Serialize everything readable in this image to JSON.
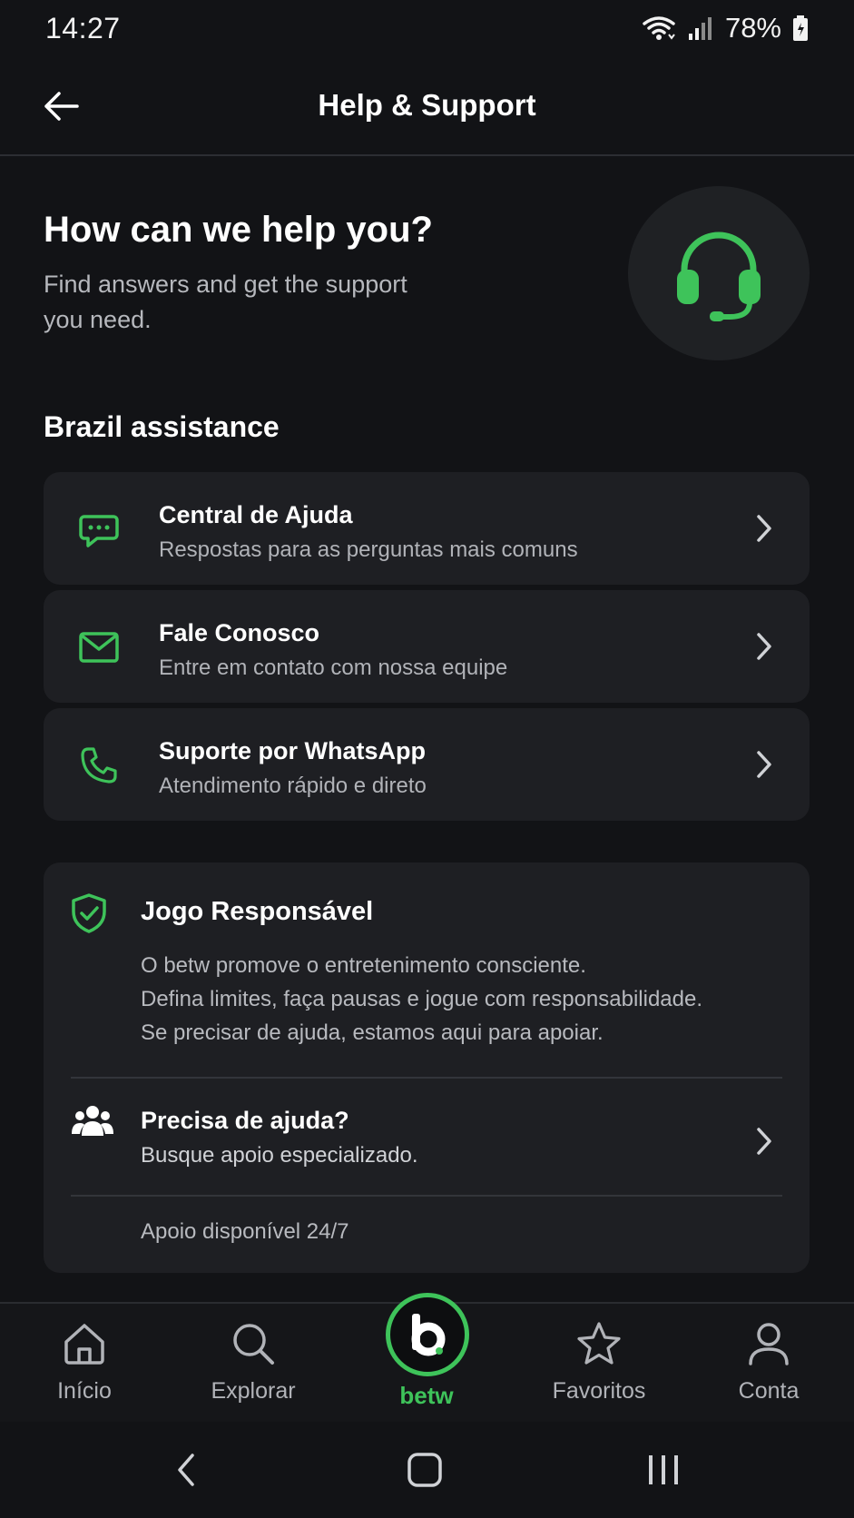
{
  "status_bar": {
    "time": "14:27",
    "battery": "78%"
  },
  "app_bar": {
    "title": "Help & Support"
  },
  "hero": {
    "title": "How can we help you?",
    "subtitle_line1": "Find answers and get the support",
    "subtitle_line2": "you need.",
    "icon": "headset-icon"
  },
  "section": {
    "title": "Brazil assistance"
  },
  "options": [
    {
      "title": "Central de Ajuda",
      "subtitle": "Respostas para as perguntas mais comuns",
      "icon": "chat-bubble-icon"
    },
    {
      "title": "Fale Conosco",
      "subtitle": "Entre em contato com nossa equipe",
      "icon": "mail-icon"
    },
    {
      "title": "Suporte por WhatsApp",
      "subtitle": "Atendimento rápido e direto",
      "icon": "phone-icon"
    }
  ],
  "responsible": {
    "title": "Jogo Responsável",
    "body_line1": "O betw promove o entretenimento consciente.",
    "body_line2": "Defina limites, faça pausas e jogue com responsabilidade.",
    "body_line3": "Se precisar de ajuda, estamos aqui para apoiar.",
    "help_title": "Precisa de ajuda?",
    "help_subtitle": "Busque apoio especializado.",
    "availability": "Apoio disponível 24/7"
  },
  "bottom_nav": {
    "items": [
      {
        "label": "Início",
        "icon": "home-icon"
      },
      {
        "label": "Explorar",
        "icon": "search-icon"
      },
      {
        "label": "betw",
        "icon": "betw-logo-icon"
      },
      {
        "label": "Favoritos",
        "icon": "star-icon"
      },
      {
        "label": "Conta",
        "icon": "user-icon"
      }
    ]
  },
  "colors": {
    "accent": "#3ec35a",
    "background": "#121316",
    "card": "#1e1f23"
  }
}
